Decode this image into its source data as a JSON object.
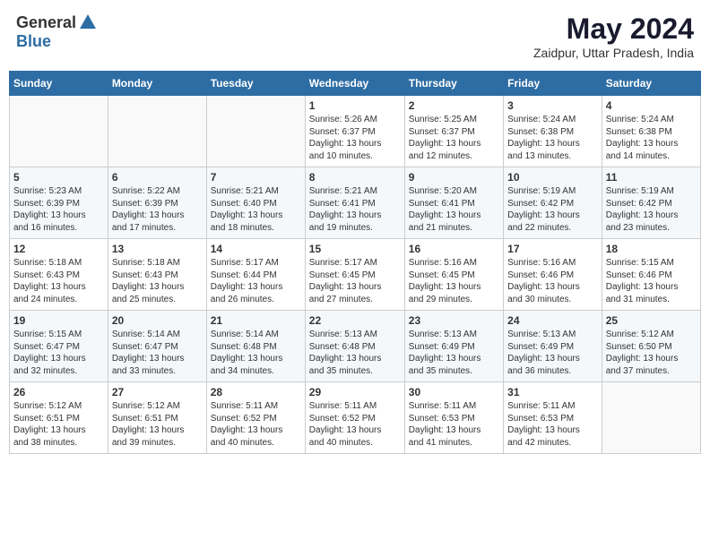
{
  "header": {
    "logo_general": "General",
    "logo_blue": "Blue",
    "month_year": "May 2024",
    "location": "Zaidpur, Uttar Pradesh, India"
  },
  "days_of_week": [
    "Sunday",
    "Monday",
    "Tuesday",
    "Wednesday",
    "Thursday",
    "Friday",
    "Saturday"
  ],
  "weeks": [
    [
      {
        "day": "",
        "info": ""
      },
      {
        "day": "",
        "info": ""
      },
      {
        "day": "",
        "info": ""
      },
      {
        "day": "1",
        "info": "Sunrise: 5:26 AM\nSunset: 6:37 PM\nDaylight: 13 hours\nand 10 minutes."
      },
      {
        "day": "2",
        "info": "Sunrise: 5:25 AM\nSunset: 6:37 PM\nDaylight: 13 hours\nand 12 minutes."
      },
      {
        "day": "3",
        "info": "Sunrise: 5:24 AM\nSunset: 6:38 PM\nDaylight: 13 hours\nand 13 minutes."
      },
      {
        "day": "4",
        "info": "Sunrise: 5:24 AM\nSunset: 6:38 PM\nDaylight: 13 hours\nand 14 minutes."
      }
    ],
    [
      {
        "day": "5",
        "info": "Sunrise: 5:23 AM\nSunset: 6:39 PM\nDaylight: 13 hours\nand 16 minutes."
      },
      {
        "day": "6",
        "info": "Sunrise: 5:22 AM\nSunset: 6:39 PM\nDaylight: 13 hours\nand 17 minutes."
      },
      {
        "day": "7",
        "info": "Sunrise: 5:21 AM\nSunset: 6:40 PM\nDaylight: 13 hours\nand 18 minutes."
      },
      {
        "day": "8",
        "info": "Sunrise: 5:21 AM\nSunset: 6:41 PM\nDaylight: 13 hours\nand 19 minutes."
      },
      {
        "day": "9",
        "info": "Sunrise: 5:20 AM\nSunset: 6:41 PM\nDaylight: 13 hours\nand 21 minutes."
      },
      {
        "day": "10",
        "info": "Sunrise: 5:19 AM\nSunset: 6:42 PM\nDaylight: 13 hours\nand 22 minutes."
      },
      {
        "day": "11",
        "info": "Sunrise: 5:19 AM\nSunset: 6:42 PM\nDaylight: 13 hours\nand 23 minutes."
      }
    ],
    [
      {
        "day": "12",
        "info": "Sunrise: 5:18 AM\nSunset: 6:43 PM\nDaylight: 13 hours\nand 24 minutes."
      },
      {
        "day": "13",
        "info": "Sunrise: 5:18 AM\nSunset: 6:43 PM\nDaylight: 13 hours\nand 25 minutes."
      },
      {
        "day": "14",
        "info": "Sunrise: 5:17 AM\nSunset: 6:44 PM\nDaylight: 13 hours\nand 26 minutes."
      },
      {
        "day": "15",
        "info": "Sunrise: 5:17 AM\nSunset: 6:45 PM\nDaylight: 13 hours\nand 27 minutes."
      },
      {
        "day": "16",
        "info": "Sunrise: 5:16 AM\nSunset: 6:45 PM\nDaylight: 13 hours\nand 29 minutes."
      },
      {
        "day": "17",
        "info": "Sunrise: 5:16 AM\nSunset: 6:46 PM\nDaylight: 13 hours\nand 30 minutes."
      },
      {
        "day": "18",
        "info": "Sunrise: 5:15 AM\nSunset: 6:46 PM\nDaylight: 13 hours\nand 31 minutes."
      }
    ],
    [
      {
        "day": "19",
        "info": "Sunrise: 5:15 AM\nSunset: 6:47 PM\nDaylight: 13 hours\nand 32 minutes."
      },
      {
        "day": "20",
        "info": "Sunrise: 5:14 AM\nSunset: 6:47 PM\nDaylight: 13 hours\nand 33 minutes."
      },
      {
        "day": "21",
        "info": "Sunrise: 5:14 AM\nSunset: 6:48 PM\nDaylight: 13 hours\nand 34 minutes."
      },
      {
        "day": "22",
        "info": "Sunrise: 5:13 AM\nSunset: 6:48 PM\nDaylight: 13 hours\nand 35 minutes."
      },
      {
        "day": "23",
        "info": "Sunrise: 5:13 AM\nSunset: 6:49 PM\nDaylight: 13 hours\nand 35 minutes."
      },
      {
        "day": "24",
        "info": "Sunrise: 5:13 AM\nSunset: 6:49 PM\nDaylight: 13 hours\nand 36 minutes."
      },
      {
        "day": "25",
        "info": "Sunrise: 5:12 AM\nSunset: 6:50 PM\nDaylight: 13 hours\nand 37 minutes."
      }
    ],
    [
      {
        "day": "26",
        "info": "Sunrise: 5:12 AM\nSunset: 6:51 PM\nDaylight: 13 hours\nand 38 minutes."
      },
      {
        "day": "27",
        "info": "Sunrise: 5:12 AM\nSunset: 6:51 PM\nDaylight: 13 hours\nand 39 minutes."
      },
      {
        "day": "28",
        "info": "Sunrise: 5:11 AM\nSunset: 6:52 PM\nDaylight: 13 hours\nand 40 minutes."
      },
      {
        "day": "29",
        "info": "Sunrise: 5:11 AM\nSunset: 6:52 PM\nDaylight: 13 hours\nand 40 minutes."
      },
      {
        "day": "30",
        "info": "Sunrise: 5:11 AM\nSunset: 6:53 PM\nDaylight: 13 hours\nand 41 minutes."
      },
      {
        "day": "31",
        "info": "Sunrise: 5:11 AM\nSunset: 6:53 PM\nDaylight: 13 hours\nand 42 minutes."
      },
      {
        "day": "",
        "info": ""
      }
    ]
  ]
}
